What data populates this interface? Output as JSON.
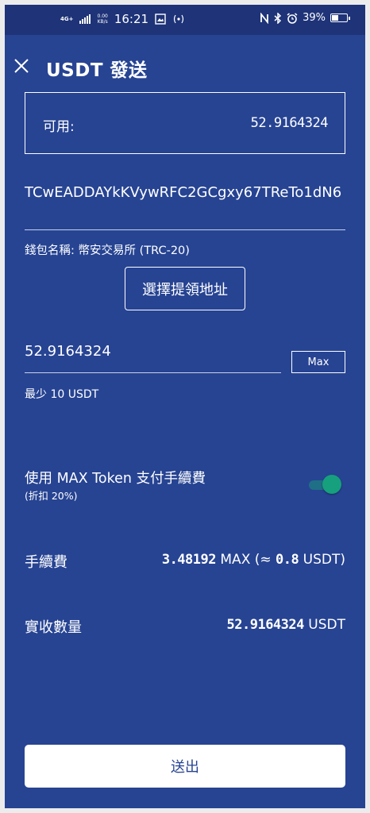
{
  "status_bar": {
    "network": "4G+",
    "speed_top": "0.00",
    "speed_bottom": "KB/s",
    "time": "16:21",
    "battery": "39%",
    "battery_level": 0.39
  },
  "header": {
    "title": "USDT 發送"
  },
  "available": {
    "label": "可用:",
    "value": "52.9164324"
  },
  "address": {
    "value": "TCwEADDAYkKVywRFC2GCgxy67TReTo1dN6"
  },
  "wallet": {
    "label": "錢包名稱:",
    "name": "幣安交易所 (TRC-20)"
  },
  "choose_address_button": "選擇提領地址",
  "amount": {
    "value": "52.9164324",
    "max_label": "Max",
    "minimum": "最少 10 USDT"
  },
  "fee_token": {
    "label": "使用 MAX Token 支付手續費",
    "discount": "(折扣 20%)",
    "enabled": true
  },
  "fee": {
    "label": "手續費",
    "amount": "3.48192",
    "unit": "MAX (≈",
    "approx": "0.8",
    "approx_unit": "USDT)"
  },
  "received": {
    "label": "實收數量",
    "amount": "52.9164324",
    "unit": "USDT"
  },
  "send_button": "送出",
  "colors": {
    "background": "#274493",
    "status_bar": "#1e3378",
    "toggle_knob": "#16a07e"
  }
}
